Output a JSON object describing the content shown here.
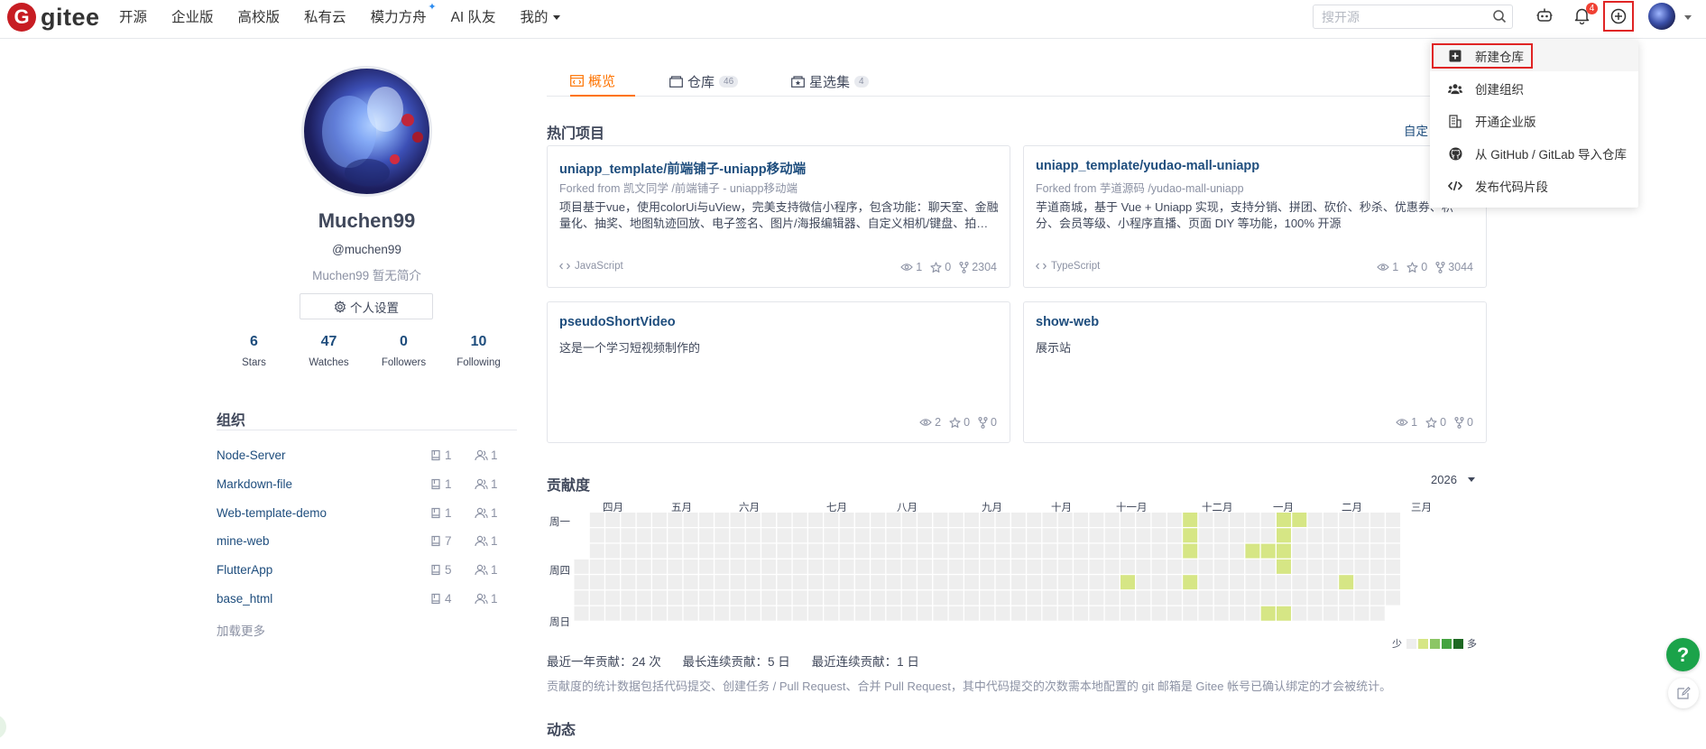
{
  "header": {
    "logo_letter": "G",
    "logo_text": "gitee",
    "nav": [
      "开源",
      "企业版",
      "高校版",
      "私有云",
      "模力方舟",
      "AI 队友",
      "我的"
    ],
    "search_placeholder": "搜开源",
    "notification_count": "4"
  },
  "dropdown": {
    "items": [
      "新建仓库",
      "创建组织",
      "开通企业版",
      "从 GitHub / GitLab 导入仓库",
      "发布代码片段"
    ]
  },
  "profile": {
    "name": "Muchen99",
    "handle": "@muchen99",
    "bio": "Muchen99 暂无简介",
    "settings_label": "个人设置",
    "stats": [
      {
        "value": "6",
        "label": "Stars"
      },
      {
        "value": "47",
        "label": "Watches"
      },
      {
        "value": "0",
        "label": "Followers"
      },
      {
        "value": "10",
        "label": "Following"
      }
    ]
  },
  "orgs": {
    "title": "组织",
    "items": [
      {
        "name": "Node-Server",
        "repos": "1",
        "members": "1"
      },
      {
        "name": "Markdown-file",
        "repos": "1",
        "members": "1"
      },
      {
        "name": "Web-template-demo",
        "repos": "1",
        "members": "1"
      },
      {
        "name": "mine-web",
        "repos": "7",
        "members": "1"
      },
      {
        "name": "FlutterApp",
        "repos": "5",
        "members": "1"
      },
      {
        "name": "base_html",
        "repos": "4",
        "members": "1"
      }
    ],
    "load_more": "加载更多"
  },
  "tabs": [
    {
      "label": "概览",
      "count": ""
    },
    {
      "label": "仓库",
      "count": "46"
    },
    {
      "label": "星选集",
      "count": "4"
    }
  ],
  "popular": {
    "title": "热门项目",
    "customize": "自定",
    "cards": [
      {
        "title": "uniapp_template/前端铺子-uniapp移动端",
        "forked": "Forked from 凯文同学 /前端铺子 - uniapp移动端",
        "desc": "项目基于vue，使用colorUi与uView，完美支持微信小程序，包含功能：聊天室、金融量化、抽奖、地图轨迹回放、电子签名、图片/海报编辑器、自定义相机/键盘、拍照图片水印、在线答题、商品分类、购物车等",
        "lang": "JavaScript",
        "watch": "1",
        "star": "0",
        "fork": "2304"
      },
      {
        "title": "uniapp_template/yudao-mall-uniapp",
        "forked": "Forked from 芋道源码 /yudao-mall-uniapp",
        "desc": "芋道商城，基于 Vue + Uniapp 实现，支持分销、拼团、砍价、秒杀、优惠券、积分、会员等级、小程序直播、页面 DIY 等功能，100% 开源",
        "lang": "TypeScript",
        "watch": "1",
        "star": "0",
        "fork": "3044"
      },
      {
        "title": "pseudoShortVideo",
        "forked": "",
        "desc": "这是一个学习短视频制作的",
        "lang": "",
        "watch": "2",
        "star": "0",
        "fork": "0"
      },
      {
        "title": "show-web",
        "forked": "",
        "desc": "展示站",
        "lang": "",
        "watch": "1",
        "star": "0",
        "fork": "0"
      }
    ]
  },
  "contribution": {
    "title": "贡献度",
    "year": "2026",
    "months": [
      "四月",
      "五月",
      "六月",
      "七月",
      "八月",
      "九月",
      "十月",
      "十一月",
      "十二月",
      "一月",
      "二月",
      "三月"
    ],
    "day_labels": [
      "周一",
      "周四",
      "周日"
    ],
    "legend_low": "少",
    "legend_high": "多",
    "colors": [
      "#eeeeee",
      "#d6e685",
      "#8cc665",
      "#44a340",
      "#1e6823"
    ],
    "levels": [
      {
        "week": 39,
        "day": 0,
        "level": 1
      },
      {
        "week": 45,
        "day": 0,
        "level": 1
      },
      {
        "week": 46,
        "day": 0,
        "level": 1
      },
      {
        "week": 39,
        "day": 1,
        "level": 1
      },
      {
        "week": 45,
        "day": 1,
        "level": 1
      },
      {
        "week": 39,
        "day": 2,
        "level": 1
      },
      {
        "week": 43,
        "day": 2,
        "level": 1
      },
      {
        "week": 44,
        "day": 2,
        "level": 1
      },
      {
        "week": 45,
        "day": 2,
        "level": 1
      },
      {
        "week": 45,
        "day": 3,
        "level": 1
      },
      {
        "week": 35,
        "day": 4,
        "level": 1
      },
      {
        "week": 39,
        "day": 4,
        "level": 1
      },
      {
        "week": 49,
        "day": 4,
        "level": 1
      },
      {
        "week": 44,
        "day": 6,
        "level": 1
      },
      {
        "week": 45,
        "day": 6,
        "level": 1
      }
    ],
    "total_label": "最近一年贡献：24 次",
    "longest_label": "最长连续贡献：5 日",
    "recent_label": "最近连续贡献：1 日",
    "note": "贡献度的统计数据包括代码提交、创建任务 / Pull Request、合并 Pull Request，其中代码提交的次数需本地配置的 git 邮箱是 Gitee 帐号已确认绑定的才会被统计。"
  },
  "activity": {
    "title": "动态"
  },
  "floating": {
    "help": "?"
  }
}
